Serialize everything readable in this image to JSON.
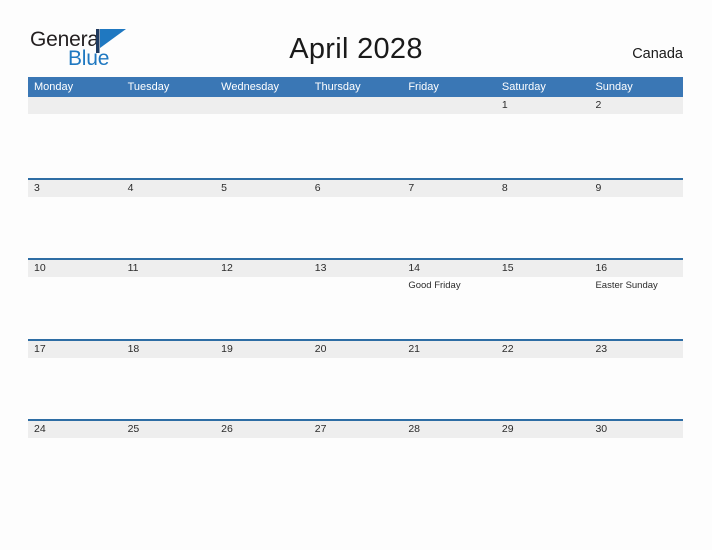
{
  "brand": {
    "name_part1": "General",
    "name_part2": "Blue",
    "flag_icon": "blue-triangle-flag-icon",
    "color_dark": "#231f20",
    "color_blue": "#1f78c1"
  },
  "header": {
    "title": "April 2028",
    "region": "Canada"
  },
  "theme": {
    "header_blue": "#3a77b5",
    "row_border_blue": "#2e6da4",
    "day_band_gray": "#eeeeee",
    "page_background": "#fdfdfd"
  },
  "calendar": {
    "month": "April",
    "year": "2028",
    "weekdays": [
      "Monday",
      "Tuesday",
      "Wednesday",
      "Thursday",
      "Friday",
      "Saturday",
      "Sunday"
    ],
    "weeks": [
      [
        {
          "day": "",
          "events": []
        },
        {
          "day": "",
          "events": []
        },
        {
          "day": "",
          "events": []
        },
        {
          "day": "",
          "events": []
        },
        {
          "day": "",
          "events": []
        },
        {
          "day": "1",
          "events": []
        },
        {
          "day": "2",
          "events": []
        }
      ],
      [
        {
          "day": "3",
          "events": []
        },
        {
          "day": "4",
          "events": []
        },
        {
          "day": "5",
          "events": []
        },
        {
          "day": "6",
          "events": []
        },
        {
          "day": "7",
          "events": []
        },
        {
          "day": "8",
          "events": []
        },
        {
          "day": "9",
          "events": []
        }
      ],
      [
        {
          "day": "10",
          "events": []
        },
        {
          "day": "11",
          "events": []
        },
        {
          "day": "12",
          "events": []
        },
        {
          "day": "13",
          "events": []
        },
        {
          "day": "14",
          "events": [
            "Good Friday"
          ]
        },
        {
          "day": "15",
          "events": []
        },
        {
          "day": "16",
          "events": [
            "Easter Sunday"
          ]
        }
      ],
      [
        {
          "day": "17",
          "events": []
        },
        {
          "day": "18",
          "events": []
        },
        {
          "day": "19",
          "events": []
        },
        {
          "day": "20",
          "events": []
        },
        {
          "day": "21",
          "events": []
        },
        {
          "day": "22",
          "events": []
        },
        {
          "day": "23",
          "events": []
        }
      ],
      [
        {
          "day": "24",
          "events": []
        },
        {
          "day": "25",
          "events": []
        },
        {
          "day": "26",
          "events": []
        },
        {
          "day": "27",
          "events": []
        },
        {
          "day": "28",
          "events": []
        },
        {
          "day": "29",
          "events": []
        },
        {
          "day": "30",
          "events": []
        }
      ]
    ]
  }
}
